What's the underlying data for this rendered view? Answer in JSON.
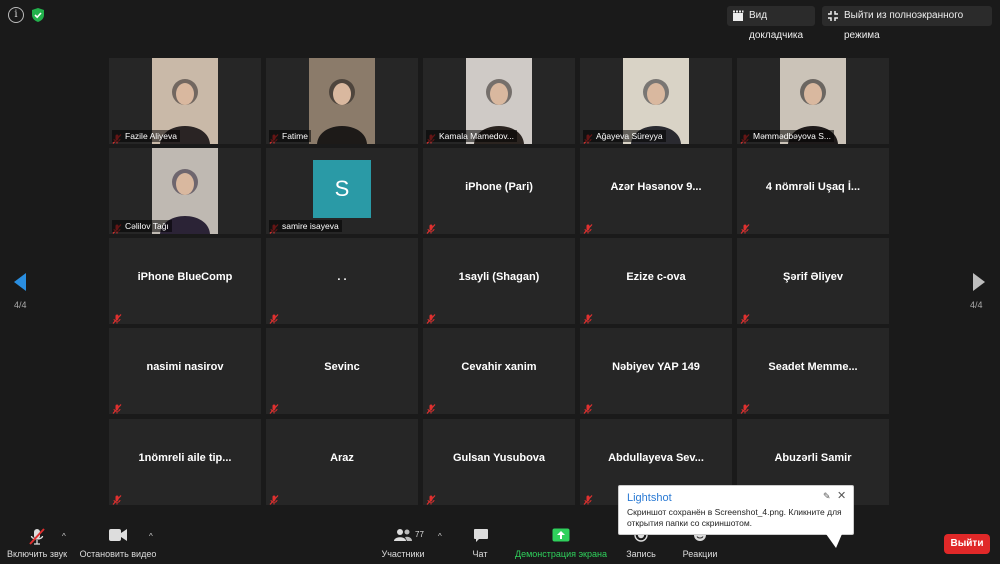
{
  "topbar": {
    "speaker_view": "Вид докладчика",
    "exit_fullscreen": "Выйти из полноэкранного режима"
  },
  "page_left": "4/4",
  "page_right": "4/4",
  "tiles": [
    {
      "name": "Fazile Aliyeva",
      "kind": "video",
      "bg": "#c9b9a8",
      "fg": "#2a2424"
    },
    {
      "name": "Fatime",
      "kind": "video",
      "bg": "#8b7b6a",
      "fg": "#1d1a18"
    },
    {
      "name": "Kamala Mamedov...",
      "kind": "video",
      "bg": "#cfcac6",
      "fg": "#2b2420"
    },
    {
      "name": "Ağayeva Süreyya",
      "kind": "video",
      "bg": "#d9d3c6",
      "fg": "#2a2a30"
    },
    {
      "name": "Məmmədbəyova S...",
      "kind": "video",
      "bg": "#cbc3b8",
      "fg": "#1e1a1a"
    },
    {
      "name": "Cəlilov Tağı",
      "kind": "video",
      "bg": "#bfb9b2",
      "fg": "#2b2336"
    },
    {
      "name": "samire isayeva",
      "kind": "avatar",
      "initial": "S"
    },
    {
      "name": "iPhone (Pari)",
      "kind": "name"
    },
    {
      "name": "Azər Həsənov 9...",
      "kind": "name"
    },
    {
      "name": "4 nömrəli Uşaq İ...",
      "kind": "name"
    },
    {
      "name": "iPhone BlueComp",
      "kind": "name"
    },
    {
      "name": ". .",
      "kind": "name"
    },
    {
      "name": "1sayli (Shagan)",
      "kind": "name"
    },
    {
      "name": "Ezize c-ova",
      "kind": "name"
    },
    {
      "name": "Şərif Əliyev",
      "kind": "name"
    },
    {
      "name": "nasimi nasirov",
      "kind": "name"
    },
    {
      "name": "Sevinc",
      "kind": "name"
    },
    {
      "name": "Cevahir xanim",
      "kind": "name"
    },
    {
      "name": "Nəbiyev YAP 149",
      "kind": "name"
    },
    {
      "name": "Seadet  Memme...",
      "kind": "name"
    },
    {
      "name": "1nömreli aile tip...",
      "kind": "name"
    },
    {
      "name": "Araz",
      "kind": "name"
    },
    {
      "name": "Gulsan Yusubova",
      "kind": "name"
    },
    {
      "name": "Abdullayeva  Sev...",
      "kind": "name"
    },
    {
      "name": "Abuzərli Samir",
      "kind": "name"
    }
  ],
  "toolbar": {
    "unmute": "Включить звук",
    "start_video": "Остановить видео",
    "participants": "Участники",
    "participants_count": "77",
    "chat": "Чат",
    "share_screen": "Демонстрация экрана",
    "record": "Запись",
    "reactions": "Реакции",
    "end": "Выйти"
  },
  "popup": {
    "title": "Lightshot",
    "message": "Скриншот сохранён в Screenshot_4.png. Кликните для открытия папки со скриншотом."
  },
  "colors": {
    "background": "#1a1a1a",
    "tile": "#262626",
    "mute_red": "#e0302f",
    "share_green": "#2fd15c",
    "end_red": "#e02828",
    "nav_blue": "#2a8ee0",
    "avatar_teal": "#2a9aa6"
  }
}
